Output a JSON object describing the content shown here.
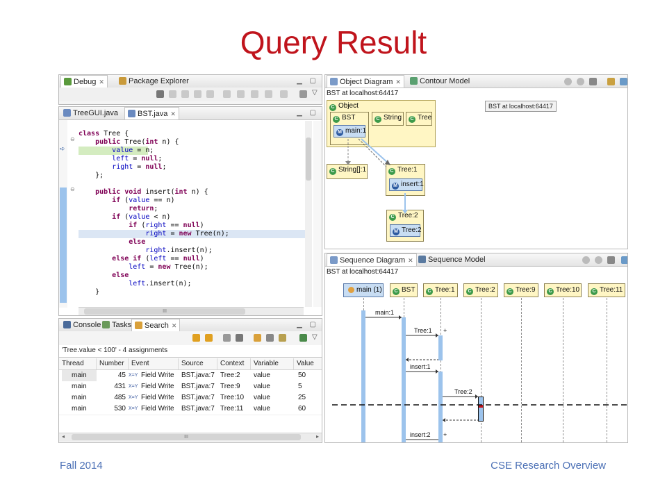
{
  "slide": {
    "title": "Query Result",
    "footer_left": "Fall 2014",
    "footer_right": "CSE Research Overview"
  },
  "debug_view": {
    "tabs": [
      {
        "label": "Debug",
        "icon": "bug-icon",
        "active": true
      },
      {
        "label": "Package Explorer",
        "icon": "package-icon",
        "active": false
      }
    ]
  },
  "editor": {
    "tabs": [
      {
        "label": "TreeGUI.java",
        "icon": "java-file-icon",
        "active": false
      },
      {
        "label": "BST.java",
        "icon": "java-file-icon",
        "active": true
      }
    ],
    "lines": [
      "class Tree {",
      "    public Tree(int n) {",
      "        value = n;",
      "        left = null;",
      "        right = null;",
      "    };",
      "",
      "    public void insert(int n) {",
      "        if (value == n)",
      "            return;",
      "        if (value < n)",
      "            if (right == null)",
      "                right = new Tree(n);",
      "            else",
      "                right.insert(n);",
      "        else if (left == null)",
      "            left = new Tree(n);",
      "        else",
      "            left.insert(n);",
      "    }"
    ],
    "scroll_label": "III"
  },
  "search_view": {
    "tabs": [
      {
        "label": "Console",
        "icon": "console-icon",
        "active": false
      },
      {
        "label": "Tasks",
        "icon": "tasks-icon",
        "active": false
      },
      {
        "label": "Search",
        "icon": "search-icon",
        "active": true
      }
    ],
    "query_summary": "'Tree.value < 100' - 4 assignments",
    "columns": [
      "Thread",
      "Number",
      "Event",
      "Source",
      "Context",
      "Variable",
      "Value"
    ],
    "rows": [
      {
        "thread": "main",
        "number": "45",
        "event": "Field Write",
        "source": "BST.java:7",
        "context": "Tree:2",
        "variable": "value",
        "value": "50"
      },
      {
        "thread": "main",
        "number": "431",
        "event": "Field Write",
        "source": "BST.java:7",
        "context": "Tree:9",
        "variable": "value",
        "value": "5"
      },
      {
        "thread": "main",
        "number": "485",
        "event": "Field Write",
        "source": "BST.java:7",
        "context": "Tree:10",
        "variable": "value",
        "value": "25"
      },
      {
        "thread": "main",
        "number": "530",
        "event": "Field Write",
        "source": "BST.java:7",
        "context": "Tree:11",
        "variable": "value",
        "value": "60"
      }
    ],
    "event_icon_text": "X=Y",
    "scroll_label": "III"
  },
  "object_diagram": {
    "tabs": [
      {
        "label": "Object Diagram",
        "icon": "diagram-icon",
        "active": true
      },
      {
        "label": "Contour Model",
        "icon": "contour-icon",
        "active": false
      }
    ],
    "header": "BST at localhost:64417",
    "tooltip": "BST at localhost:64417",
    "object_label": "Object",
    "nodes": {
      "bst": "BST",
      "string": "String",
      "tree": "Tree",
      "main": "main:1",
      "string_array": "String[]:1",
      "tree1": "Tree:1",
      "insert1": "insert:1",
      "tree2": "Tree:2",
      "tree2_inner": "Tree:2"
    }
  },
  "sequence_diagram": {
    "tabs": [
      {
        "label": "Sequence Diagram",
        "icon": "sequence-icon",
        "active": true
      },
      {
        "label": "Sequence Model",
        "icon": "model-icon",
        "active": false
      }
    ],
    "header": "BST at localhost:64417",
    "lifelines": [
      "main (1)",
      "BST",
      "Tree:1",
      "Tree:2",
      "Tree:9",
      "Tree:10",
      "Tree:11"
    ],
    "messages": [
      "main:1",
      "Tree:1",
      "insert:1",
      "Tree:2",
      "insert:2"
    ],
    "plus_marks": [
      "+",
      "+"
    ]
  },
  "colors": {
    "title": "#c0141c",
    "footer": "#4a6fb5",
    "node_fill": "#fff6c4",
    "method_fill": "#c8ddf3",
    "activation": "#9cc3ec",
    "current_line": "#d4ecc0"
  }
}
